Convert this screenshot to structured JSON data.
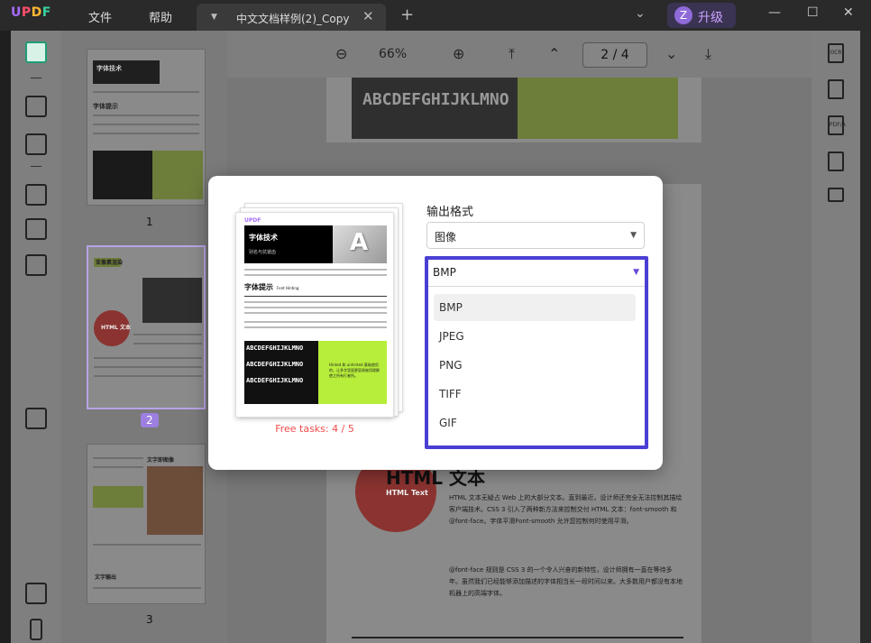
{
  "app": {
    "logo": "UPDF",
    "menu": [
      "文件",
      "帮助"
    ],
    "tab_title": "中文文档样例(2)_Copy",
    "upgrade_avatar": "Z",
    "upgrade_label": "升级",
    "window": {
      "minimize": "—",
      "maximize": "☐",
      "close": "✕"
    }
  },
  "toolbar": {
    "zoom_out": "⊖",
    "zoom": "66%",
    "zoom_in": "⊕",
    "page_indicator": "2 / 4"
  },
  "thumbnails": [
    {
      "number": "1",
      "heading": "字体技术",
      "sub": "字体提示",
      "selected": false
    },
    {
      "number": "2",
      "heading": "亚像素渲染",
      "sub": "HTML 文本",
      "selected": true
    },
    {
      "number": "3",
      "heading": "文字即图像",
      "sub": "文字输出",
      "selected": false
    }
  ],
  "document": {
    "banner_text": "ABCDEFGHIJKLMNO",
    "section_title": "HTML 文本",
    "section_sub": "HTML Text",
    "paragraph1": "HTML 文本无疑占 Web 上的大部分文本。直到最近，设计师还完全无法控制其描绘客户端技术。CSS 3 引入了两种新方法来控制交付 HTML 文本：font-smooth 和 @font-face。字体平滑Font-smooth 允许您控制何时使用平滑。",
    "paragraph2": "@font-face 规则是 CSS 3 的一个令人兴奋的新特性，设计师拥有一直在等待多年。虽然我们已经能够添加描述的字体相当长一段时间以来。大多数用户都没有本地机器上的高端字体。"
  },
  "right_icons": [
    "OCR",
    "convert",
    "PDF/A",
    "protect",
    "mail"
  ],
  "dialog": {
    "preview": {
      "logo": "UPDF",
      "title": "字体技术",
      "subtitle": "别名与抗锯齿",
      "heading": "字体提示",
      "heading_en": "Font Hinting",
      "image_text": "ABCDEFGHIJKLMNO",
      "green_text": "Hinted 和 unhinted 基础使用的，让多字里面更容易被用理解使之所有打者所。"
    },
    "free_tasks": "Free tasks: 4 / 5",
    "format_label": "输出格式",
    "format_value": "图像",
    "image_format_value": "BMP",
    "options": [
      "BMP",
      "JPEG",
      "PNG",
      "TIFF",
      "GIF"
    ],
    "accent_color": "#4a3fd4"
  }
}
